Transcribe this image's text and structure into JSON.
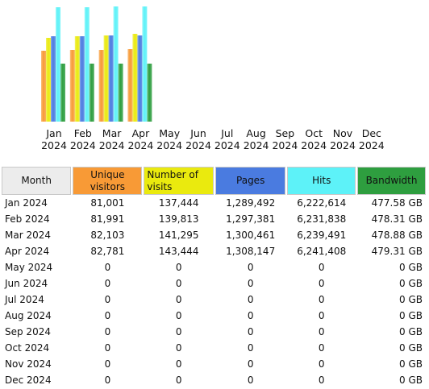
{
  "colors": {
    "unique_visitors": "#f89a36",
    "visits": "#eaea0e",
    "pages": "#4a7be0",
    "hits": "#5df2f8",
    "bandwidth": "#2e9e3f",
    "header_month": "#ececec"
  },
  "chart_data": {
    "type": "bar",
    "categories": [
      "Jan 2024",
      "Feb 2024",
      "Mar 2024",
      "Apr 2024",
      "May 2024",
      "Jun 2024",
      "Jul 2024",
      "Aug 2024",
      "Sep 2024",
      "Oct 2024",
      "Nov 2024",
      "Dec 2024"
    ],
    "category_lines": [
      [
        "Jan",
        "2024"
      ],
      [
        "Feb",
        "2024"
      ],
      [
        "Mar",
        "2024"
      ],
      [
        "Apr",
        "2024"
      ],
      [
        "May",
        "2024"
      ],
      [
        "Jun",
        "2024"
      ],
      [
        "Jul",
        "2024"
      ],
      [
        "Aug",
        "2024"
      ],
      [
        "Sep",
        "2024"
      ],
      [
        "Oct",
        "2024"
      ],
      [
        "Nov",
        "2024"
      ],
      [
        "Dec",
        "2024"
      ]
    ],
    "series": [
      {
        "key": "unique_visitors",
        "values": [
          81001,
          81991,
          82103,
          82781,
          0,
          0,
          0,
          0,
          0,
          0,
          0,
          0
        ]
      },
      {
        "key": "visits",
        "values": [
          137444,
          139813,
          141295,
          143444,
          0,
          0,
          0,
          0,
          0,
          0,
          0,
          0
        ]
      },
      {
        "key": "pages",
        "values": [
          1289492,
          1297381,
          1300461,
          1308147,
          0,
          0,
          0,
          0,
          0,
          0,
          0,
          0
        ]
      },
      {
        "key": "hits",
        "values": [
          6222614,
          6231838,
          6239491,
          6241408,
          0,
          0,
          0,
          0,
          0,
          0,
          0,
          0
        ]
      },
      {
        "key": "bandwidth",
        "values": [
          477.58,
          478.31,
          478.88,
          479.31,
          0,
          0,
          0,
          0,
          0,
          0,
          0,
          0
        ]
      }
    ]
  },
  "table": {
    "headers": {
      "month": "Month",
      "unique_visitors": "Unique visitors",
      "visits": "Number of visits",
      "pages": "Pages",
      "hits": "Hits",
      "bandwidth": "Bandwidth"
    },
    "rows": [
      {
        "month": "Jan 2024",
        "uv": "81,001",
        "visits": "137,444",
        "pages": "1,289,492",
        "hits": "6,222,614",
        "bw": "477.58 GB"
      },
      {
        "month": "Feb 2024",
        "uv": "81,991",
        "visits": "139,813",
        "pages": "1,297,381",
        "hits": "6,231,838",
        "bw": "478.31 GB"
      },
      {
        "month": "Mar 2024",
        "uv": "82,103",
        "visits": "141,295",
        "pages": "1,300,461",
        "hits": "6,239,491",
        "bw": "478.88 GB"
      },
      {
        "month": "Apr 2024",
        "uv": "82,781",
        "visits": "143,444",
        "pages": "1,308,147",
        "hits": "6,241,408",
        "bw": "479.31 GB"
      },
      {
        "month": "May 2024",
        "uv": "0",
        "visits": "0",
        "pages": "0",
        "hits": "0",
        "bw": "0 GB"
      },
      {
        "month": "Jun 2024",
        "uv": "0",
        "visits": "0",
        "pages": "0",
        "hits": "0",
        "bw": "0 GB"
      },
      {
        "month": "Jul 2024",
        "uv": "0",
        "visits": "0",
        "pages": "0",
        "hits": "0",
        "bw": "0 GB"
      },
      {
        "month": "Aug 2024",
        "uv": "0",
        "visits": "0",
        "pages": "0",
        "hits": "0",
        "bw": "0 GB"
      },
      {
        "month": "Sep 2024",
        "uv": "0",
        "visits": "0",
        "pages": "0",
        "hits": "0",
        "bw": "0 GB"
      },
      {
        "month": "Oct 2024",
        "uv": "0",
        "visits": "0",
        "pages": "0",
        "hits": "0",
        "bw": "0 GB"
      },
      {
        "month": "Nov 2024",
        "uv": "0",
        "visits": "0",
        "pages": "0",
        "hits": "0",
        "bw": "0 GB"
      },
      {
        "month": "Dec 2024",
        "uv": "0",
        "visits": "0",
        "pages": "0",
        "hits": "0",
        "bw": "0 GB"
      }
    ]
  }
}
